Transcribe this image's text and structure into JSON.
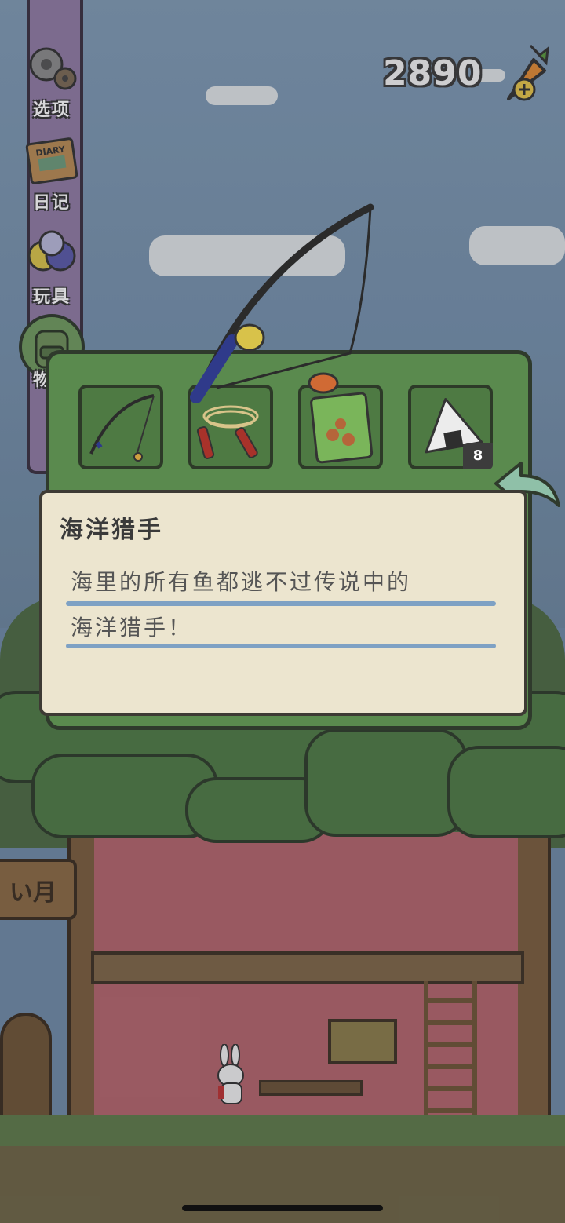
{
  "sidebar": {
    "items": [
      {
        "label": "选项",
        "icon": "gear-icon"
      },
      {
        "label": "日记",
        "icon": "diary-icon",
        "icon_text": "DIARY"
      },
      {
        "label": "玩具",
        "icon": "toys-icon"
      },
      {
        "label": "物品",
        "icon": "backpack-icon"
      }
    ]
  },
  "currency": {
    "amount": "2890",
    "icon": "carrot-add-icon"
  },
  "inventory": {
    "slots": [
      {
        "item": "fishing-rod-icon"
      },
      {
        "item": "jump-rope-icon"
      },
      {
        "item": "seed-packet-icon"
      },
      {
        "item": "rice-ball-icon",
        "count": "8"
      }
    ],
    "selected_item": "fishing-rod-icon"
  },
  "detail": {
    "title": "海洋猎手",
    "lines": [
      "海里的所有鱼都逃不过传说中的",
      "海洋猎手！"
    ]
  },
  "sign": {
    "text": "い月"
  },
  "colors": {
    "panel_green": "#5a8a4e",
    "paper": "#ece5cf",
    "rule_blue": "#7ea1c4",
    "sidebar_purple": "#8f7aa3"
  }
}
